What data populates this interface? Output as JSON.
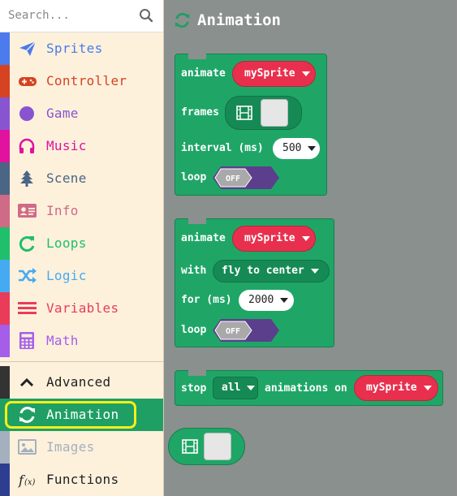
{
  "search": {
    "placeholder": "Search..."
  },
  "sidebar": {
    "items": [
      {
        "label": "Sprites",
        "color": "#4b7bec",
        "icon": "paper-plane-icon"
      },
      {
        "label": "Controller",
        "color": "#d54322",
        "icon": "gamepad-icon"
      },
      {
        "label": "Game",
        "color": "#8854d0",
        "icon": "circle-icon"
      },
      {
        "label": "Music",
        "color": "#e0129e",
        "icon": "headphones-icon"
      },
      {
        "label": "Scene",
        "color": "#4b6584",
        "icon": "tree-icon"
      },
      {
        "label": "Info",
        "color": "#cf6a87",
        "icon": "id-card-icon"
      },
      {
        "label": "Loops",
        "color": "#20bf6b",
        "icon": "refresh-icon"
      },
      {
        "label": "Logic",
        "color": "#45aaf2",
        "icon": "shuffle-icon"
      },
      {
        "label": "Variables",
        "color": "#eb3b5a",
        "icon": "list-icon"
      },
      {
        "label": "Math",
        "color": "#a55eea",
        "icon": "calculator-icon"
      }
    ],
    "advanced": {
      "label": "Advanced",
      "color": "#333333",
      "icon": "chevron-up-icon"
    },
    "animation": {
      "label": "Animation",
      "color": "#1f9f64",
      "icon": "refresh-icon"
    },
    "images": {
      "label": "Images",
      "color": "#a4b0be",
      "icon": "image-icon"
    },
    "functions": {
      "label": "Functions",
      "color": "#2f3d91",
      "icon": "function-icon"
    }
  },
  "workspace": {
    "title": "Animation",
    "block1": {
      "animate": "animate",
      "sprite": "mySprite",
      "frames": "frames",
      "interval": "interval (ms)",
      "interval_value": "500",
      "loop": "loop",
      "loop_value": "OFF"
    },
    "block2": {
      "animate": "animate",
      "sprite": "mySprite",
      "with": "with",
      "path": "fly to center",
      "for": "for (ms)",
      "for_value": "2000",
      "loop": "loop",
      "loop_value": "OFF"
    },
    "block3": {
      "stop": "stop",
      "which": "all",
      "animations_on": "animations on",
      "sprite": "mySprite"
    }
  }
}
